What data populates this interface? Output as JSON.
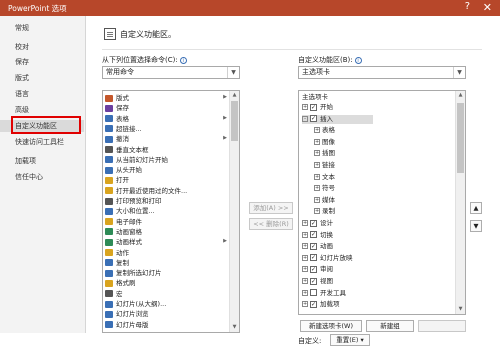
{
  "window": {
    "title": "PowerPoint 选项",
    "help": "?",
    "close": "✕"
  },
  "sidebar": {
    "items": [
      {
        "label": "常规"
      },
      {
        "label": "校对"
      },
      {
        "label": "保存"
      },
      {
        "label": "版式"
      },
      {
        "label": "语言"
      },
      {
        "label": "高级"
      },
      {
        "label": "自定义功能区",
        "active": true
      },
      {
        "label": "快速访问工具栏"
      },
      {
        "label": "加载项"
      },
      {
        "label": "信任中心"
      }
    ]
  },
  "header": {
    "title": "自定义功能区。"
  },
  "left_panel": {
    "choose_label": "从下列位置选择命令(C):",
    "choose_value": "常用命令",
    "commands": [
      {
        "label": "版式",
        "icon": "layout-icon",
        "color": "#c4572b",
        "submenu": true
      },
      {
        "label": "保存",
        "icon": "save-icon",
        "color": "#6b3fa0"
      },
      {
        "label": "表格",
        "icon": "table-icon",
        "color": "#3a6fb5",
        "submenu": true
      },
      {
        "label": "超链接...",
        "icon": "link-icon",
        "color": "#3a6fb5"
      },
      {
        "label": "撤消",
        "icon": "undo-icon",
        "color": "#3a6fb5",
        "submenu": true
      },
      {
        "label": "垂直文本框",
        "icon": "textbox-icon",
        "color": "#555555"
      },
      {
        "label": "从当前幻灯片开始",
        "icon": "play-current-icon",
        "color": "#3a6fb5"
      },
      {
        "label": "从头开始",
        "icon": "play-start-icon",
        "color": "#3a6fb5"
      },
      {
        "label": "打开",
        "icon": "open-icon",
        "color": "#d9a41f"
      },
      {
        "label": "打开最近使用过的文件...",
        "icon": "recent-icon",
        "color": "#d9a41f"
      },
      {
        "label": "打印预览和打印",
        "icon": "print-icon",
        "color": "#555555"
      },
      {
        "label": "大小和位置...",
        "icon": "size-icon",
        "color": "#3a6fb5"
      },
      {
        "label": "电子邮件",
        "icon": "mail-icon",
        "color": "#d9a41f"
      },
      {
        "label": "动画窗格",
        "icon": "anim-pane-icon",
        "color": "#2e8b57"
      },
      {
        "label": "动画样式",
        "icon": "anim-style-icon",
        "color": "#2e8b57",
        "submenu": true
      },
      {
        "label": "动作",
        "icon": "action-icon",
        "color": "#d9a41f"
      },
      {
        "label": "复制",
        "icon": "copy-icon",
        "color": "#3a6fb5"
      },
      {
        "label": "复制所选幻灯片",
        "icon": "dup-slide-icon",
        "color": "#3a6fb5"
      },
      {
        "label": "格式刷",
        "icon": "brush-icon",
        "color": "#d9a41f"
      },
      {
        "label": "宏",
        "icon": "macro-icon",
        "color": "#555555"
      },
      {
        "label": "幻灯片(从大纲)...",
        "icon": "slide-outline-icon",
        "color": "#3a6fb5"
      },
      {
        "label": "幻灯片浏览",
        "icon": "slide-sorter-icon",
        "color": "#3a6fb5"
      },
      {
        "label": "幻灯片母版",
        "icon": "slide-master-icon",
        "color": "#3a6fb5"
      }
    ]
  },
  "middle": {
    "add_label": "添加(A) >>",
    "remove_label": "<< 删除(R)"
  },
  "right_panel": {
    "customize_label": "自定义功能区(B):",
    "customize_value": "主选项卡",
    "tree_header": "主选项卡",
    "tree": [
      {
        "label": "开始",
        "level": 0,
        "expander": "+",
        "checked": true
      },
      {
        "label": "插入",
        "level": 0,
        "expander": "-",
        "checked": true,
        "selected": true
      },
      {
        "label": "表格",
        "level": 1,
        "expander": "+"
      },
      {
        "label": "图像",
        "level": 1,
        "expander": "+"
      },
      {
        "label": "插图",
        "level": 1,
        "expander": "+"
      },
      {
        "label": "链接",
        "level": 1,
        "expander": "+"
      },
      {
        "label": "文本",
        "level": 1,
        "expander": "+"
      },
      {
        "label": "符号",
        "level": 1,
        "expander": "+"
      },
      {
        "label": "媒体",
        "level": 1,
        "expander": "+"
      },
      {
        "label": "录制",
        "level": 1,
        "expander": "+"
      },
      {
        "label": "设计",
        "level": 0,
        "expander": "+",
        "checked": true
      },
      {
        "label": "切换",
        "level": 0,
        "expander": "+",
        "checked": true
      },
      {
        "label": "动画",
        "level": 0,
        "expander": "+",
        "checked": true
      },
      {
        "label": "幻灯片放映",
        "level": 0,
        "expander": "+",
        "checked": true
      },
      {
        "label": "审阅",
        "level": 0,
        "expander": "+",
        "checked": true
      },
      {
        "label": "视图",
        "level": 0,
        "expander": "+",
        "checked": true
      },
      {
        "label": "开发工具",
        "level": 0,
        "expander": "+",
        "checked": false
      },
      {
        "label": "加载项",
        "level": 0,
        "expander": "+",
        "checked": true
      }
    ],
    "new_tab_label": "新建选项卡(W)",
    "new_group_label": "新建组",
    "customizations_label": "自定义:",
    "reset_label": "重置(E) ▾"
  }
}
